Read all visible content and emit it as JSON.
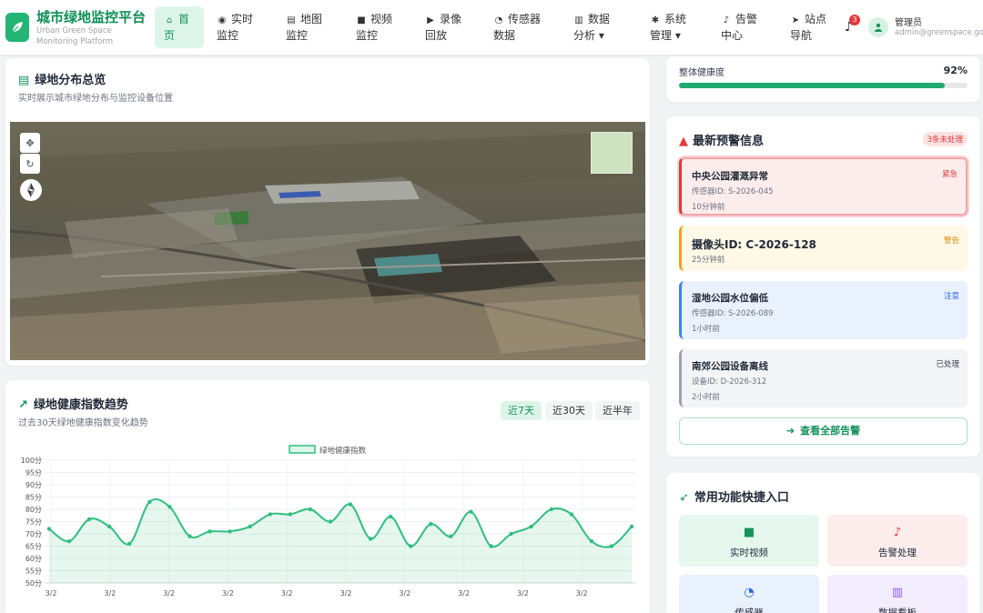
{
  "app": {
    "title": "城市绿地监控平台",
    "subtitle": "Urban Green Space Monitoring Platform",
    "logo_icon": "leaf-icon"
  },
  "nav": [
    {
      "icon": "home-icon",
      "glyph": "⌂",
      "label": "首页",
      "active": true
    },
    {
      "icon": "eye-icon",
      "glyph": "◉",
      "label": "实时监控"
    },
    {
      "icon": "map-icon",
      "glyph": "▤",
      "label": "地图监控"
    },
    {
      "icon": "video-icon",
      "glyph": "■",
      "label": "视频监控"
    },
    {
      "icon": "play-icon",
      "glyph": "▶",
      "label": "录像回放"
    },
    {
      "icon": "dashboard-icon",
      "glyph": "◔",
      "label": "传感器数据"
    },
    {
      "icon": "bar-chart-icon",
      "glyph": "▥",
      "label": "数据分析 ▾"
    },
    {
      "icon": "gear-icon",
      "glyph": "✱",
      "label": "系统管理 ▾"
    },
    {
      "icon": "bell-icon",
      "glyph": "♪",
      "label": "告警中心"
    },
    {
      "icon": "location-arrow-icon",
      "glyph": "➤",
      "label": "站点导航"
    }
  ],
  "notifications": {
    "count": "3"
  },
  "user": {
    "name": "管理员",
    "email": "admin@greenspace.gov"
  },
  "map_card": {
    "title": "绿地分布总览",
    "subtitle": "实时展示城市绿地分布与监控设备位置"
  },
  "trend_card": {
    "title": "绿地健康指数趋势",
    "subtitle": "过去30天绿地健康指数变化趋势",
    "ranges": [
      {
        "label": "近7天",
        "active": true
      },
      {
        "label": "近30天",
        "active": false
      },
      {
        "label": "近半年",
        "active": false
      }
    ]
  },
  "health": {
    "label": "整体健康度",
    "value_text": "92%",
    "value": 0.92
  },
  "alerts_card": {
    "title": "最新预警信息",
    "badge": "3条未处理",
    "items": [
      {
        "title": "中央公园灌溉异常",
        "id": "传感器ID: S-2026-045",
        "time": "10分钟前",
        "tag": "紧急"
      },
      {
        "title": "摄像头ID: C-2026-128",
        "id": "",
        "time": "25分钟前",
        "tag": "警告"
      },
      {
        "title": "湿地公园水位偏低",
        "id": "传感器ID: S-2026-089",
        "time": "1小时前",
        "tag": "注意"
      },
      {
        "title": "南郊公园设备离线",
        "id": "设备ID: D-2026-312",
        "time": "2小时前",
        "tag": "已处理"
      }
    ],
    "view_all": "查看全部告警"
  },
  "quick_card": {
    "title": "常用功能快捷入口",
    "items": [
      {
        "icon": "video-icon",
        "label": "实时视频"
      },
      {
        "icon": "bell-icon",
        "label": "告警处理"
      },
      {
        "icon": "dashboard-icon",
        "label": "传感器"
      },
      {
        "icon": "bar-chart-icon",
        "label": "数据看板"
      }
    ]
  },
  "colors": {
    "brand": "#22b573",
    "danger": "#e5383b",
    "warning": "#f0a020",
    "info": "#3b82f6",
    "muted": "#9ca3af"
  },
  "chart_data": {
    "type": "area",
    "series": [
      {
        "name": "绿地健康指数",
        "values": [
          72,
          67,
          76,
          73,
          66,
          83,
          81,
          69,
          71,
          71,
          73,
          78,
          78,
          80,
          75,
          82,
          68,
          77,
          65,
          74,
          69,
          79,
          65,
          70,
          73,
          80,
          78,
          67,
          65,
          73
        ]
      }
    ],
    "x": [
      "3/2",
      "3/2",
      "3/2",
      "3/2",
      "3/2",
      "3/2",
      "3/2",
      "3/2",
      "3/2",
      "3/2"
    ],
    "ylim": [
      50,
      100
    ],
    "yticks": [
      "100分",
      "95分",
      "90分",
      "85分",
      "80分",
      "75分",
      "70分",
      "65分",
      "60分",
      "55分",
      "50分"
    ],
    "grid": true,
    "legend_position": "top-center",
    "color": "#2fbf7f"
  }
}
